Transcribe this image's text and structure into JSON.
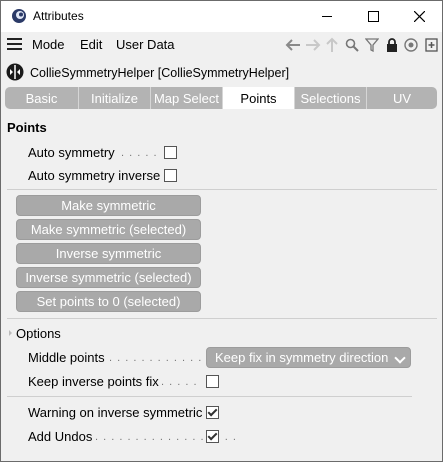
{
  "window": {
    "title": "Attributes",
    "minimize_icon": "minimize-icon",
    "maximize_icon": "maximize-icon",
    "close_icon": "close-icon"
  },
  "menubar": {
    "items": [
      {
        "label": "Mode"
      },
      {
        "label": "Edit"
      },
      {
        "label": "User Data"
      }
    ],
    "toolbar_icons": [
      "back-arrow-icon",
      "forward-arrow-icon",
      "up-arrow-icon",
      "search-icon",
      "filter-icon",
      "lock-icon",
      "target-icon",
      "new-panel-icon"
    ]
  },
  "object": {
    "title": "CollieSymmetryHelper [CollieSymmetryHelper]"
  },
  "tabs": [
    {
      "label": "Basic",
      "active": false
    },
    {
      "label": "Initialize",
      "active": false
    },
    {
      "label": "Map Select",
      "active": false
    },
    {
      "label": "Points",
      "active": true
    },
    {
      "label": "Selections",
      "active": false
    },
    {
      "label": "UV",
      "active": false
    }
  ],
  "points": {
    "title": "Points",
    "auto_symmetry": {
      "label": "Auto symmetry",
      "dots": ". . . . .",
      "checked": false
    },
    "auto_symmetry_inverse": {
      "label": "Auto symmetry inverse",
      "checked": false
    },
    "buttons": [
      {
        "label": "Make symmetric"
      },
      {
        "label": "Make symmetric (selected)"
      },
      {
        "label": "Inverse symmetric"
      },
      {
        "label": "Inverse symmetric (selected)"
      },
      {
        "label": "Set points to 0 (selected)"
      }
    ]
  },
  "options": {
    "title": "Options",
    "middle_points": {
      "label": "Middle points",
      "dots": ". . . . . . . . . . . .",
      "value": "Keep fix in symmetry direction"
    },
    "keep_inverse": {
      "label": "Keep inverse points fix",
      "dots": ". . . . .",
      "checked": false
    },
    "warning_inverse": {
      "label": "Warning on inverse symmetric",
      "checked": true
    },
    "add_undos": {
      "label": "Add Undos",
      "dots": ". . . . . . . . . . . . . . . . . .",
      "checked": true
    }
  },
  "colors": {
    "button_gray": "#a9a9a9",
    "tab_gray": "#b3b3b3",
    "background": "#f0f0f0"
  }
}
